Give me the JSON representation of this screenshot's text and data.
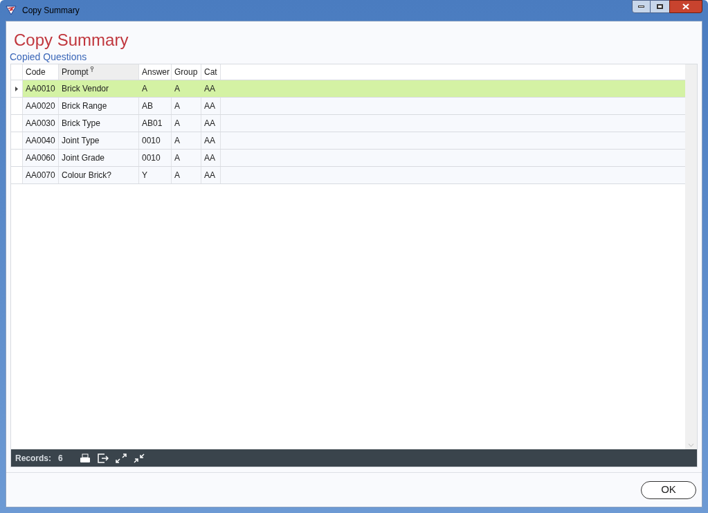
{
  "window": {
    "title": "Copy Summary"
  },
  "heading": "Copy Summary",
  "subheading": "Copied Questions",
  "table": {
    "columns": [
      {
        "label": "Code",
        "filtered": false
      },
      {
        "label": "Prompt",
        "filtered": true
      },
      {
        "label": "Answer",
        "filtered": false
      },
      {
        "label": "Group",
        "filtered": false
      },
      {
        "label": "Cat",
        "filtered": false
      }
    ],
    "rows": [
      {
        "cells": [
          "AA0010",
          "Brick Vendor",
          "A",
          "A",
          "AA"
        ],
        "selected": true
      },
      {
        "cells": [
          "AA0020",
          "Brick Range",
          "AB",
          "A",
          "AA"
        ],
        "selected": false
      },
      {
        "cells": [
          "AA0030",
          "Brick Type",
          "AB01",
          "A",
          "AA"
        ],
        "selected": false
      },
      {
        "cells": [
          "AA0040",
          "Joint Type",
          "0010",
          "A",
          "AA"
        ],
        "selected": false
      },
      {
        "cells": [
          "AA0060",
          "Joint Grade",
          "0010",
          "A",
          "AA"
        ],
        "selected": false
      },
      {
        "cells": [
          "AA0070",
          "Colour Brick?",
          "Y",
          "A",
          "AA"
        ],
        "selected": false
      }
    ]
  },
  "footer": {
    "label": "Records:",
    "count": "6"
  },
  "buttons": [
    "OK"
  ]
}
